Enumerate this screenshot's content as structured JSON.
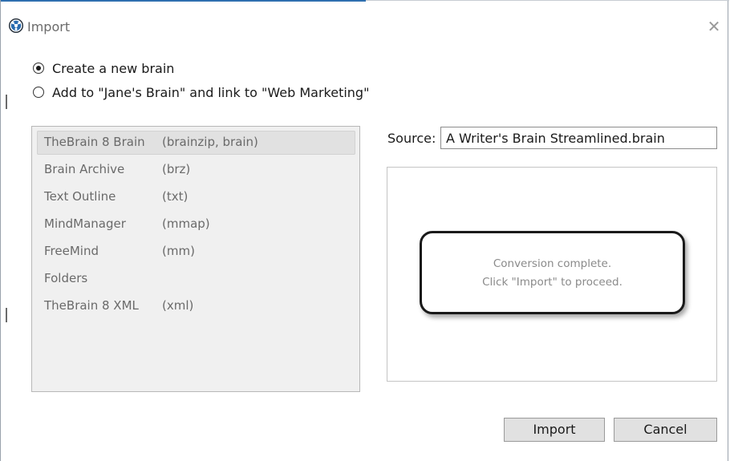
{
  "window": {
    "title": "Import",
    "close_glyph": "✕"
  },
  "options": [
    {
      "label": "Create a new brain",
      "checked": true
    },
    {
      "label": "Add to \"Jane's Brain\" and link to \"Web Marketing\"",
      "checked": false
    }
  ],
  "formats": [
    {
      "name": "TheBrain 8 Brain",
      "ext": "(brainzip, brain)",
      "selected": true
    },
    {
      "name": "Brain Archive",
      "ext": "(brz)",
      "selected": false
    },
    {
      "name": "Text Outline",
      "ext": "(txt)",
      "selected": false
    },
    {
      "name": "MindManager",
      "ext": "(mmap)",
      "selected": false
    },
    {
      "name": "FreeMind",
      "ext": "(mm)",
      "selected": false
    },
    {
      "name": "Folders",
      "ext": "",
      "selected": false
    },
    {
      "name": "TheBrain 8 XML",
      "ext": "(xml)",
      "selected": false
    }
  ],
  "source": {
    "label": "Source:",
    "value": "A Writer's Brain Streamlined.brain"
  },
  "status": {
    "line1": "Conversion complete.",
    "line2": "Click \"Import\" to proceed."
  },
  "buttons": {
    "import_label": "Import",
    "cancel_label": "Cancel"
  },
  "icons": {
    "app": "thebrain-logo-icon",
    "close": "close-icon"
  },
  "colors": {
    "accent": "#2f6fb0",
    "list_bg": "#f0f0f0",
    "selected_bg": "#e1e1e1",
    "button_bg": "#e1e1e1"
  }
}
